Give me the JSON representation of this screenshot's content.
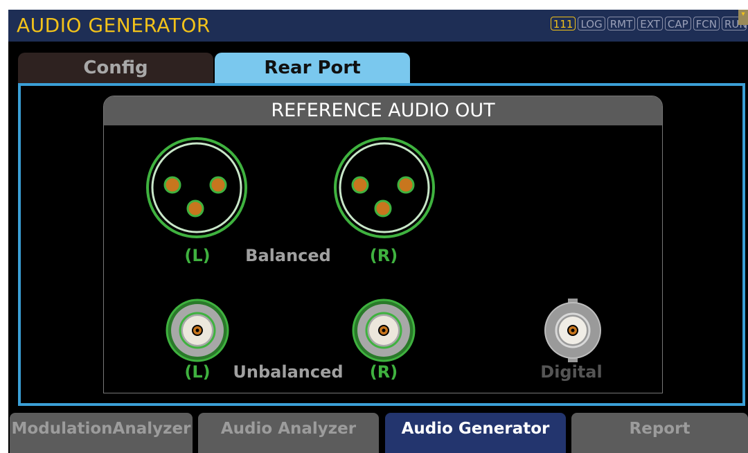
{
  "app": {
    "title": "AUDIO GENERATOR"
  },
  "status_indicators": [
    {
      "label": "111",
      "active": true
    },
    {
      "label": "LOG",
      "active": false
    },
    {
      "label": "RMT",
      "active": false
    },
    {
      "label": "EXT",
      "active": false
    },
    {
      "label": "CAP",
      "active": false
    },
    {
      "label": "FCN",
      "active": false
    },
    {
      "label": "RUN",
      "active": false
    }
  ],
  "tabs": [
    {
      "label": "Config",
      "selected": false
    },
    {
      "label": "Rear Port",
      "selected": true
    }
  ],
  "panel": {
    "title": "REFERENCE AUDIO OUT",
    "balanced": {
      "left_label": "(L)",
      "center_label": "Balanced",
      "right_label": "(R)"
    },
    "unbalanced": {
      "left_label": "(L)",
      "center_label": "Unbalanced",
      "right_label": "(R)"
    },
    "digital": {
      "label": "Digital"
    }
  },
  "bottom_tabs": [
    {
      "label": "ModulationAnalyzer",
      "selected": false
    },
    {
      "label": "Audio  Analyzer",
      "selected": false
    },
    {
      "label": "Audio  Generator",
      "selected": true
    },
    {
      "label": "Report",
      "selected": false
    }
  ],
  "colors": {
    "accent_yellow": "#f2c21a",
    "connector_green": "#3fb23f",
    "connector_pin": "#c8761e",
    "selected_tab": "#7ac8ee",
    "panel_border": "#3b9fd6",
    "bottom_active": "#23356e"
  },
  "icons": [
    "xlr-female-connector-icon",
    "bnc-connector-icon",
    "bnc-digital-connector-icon"
  ]
}
